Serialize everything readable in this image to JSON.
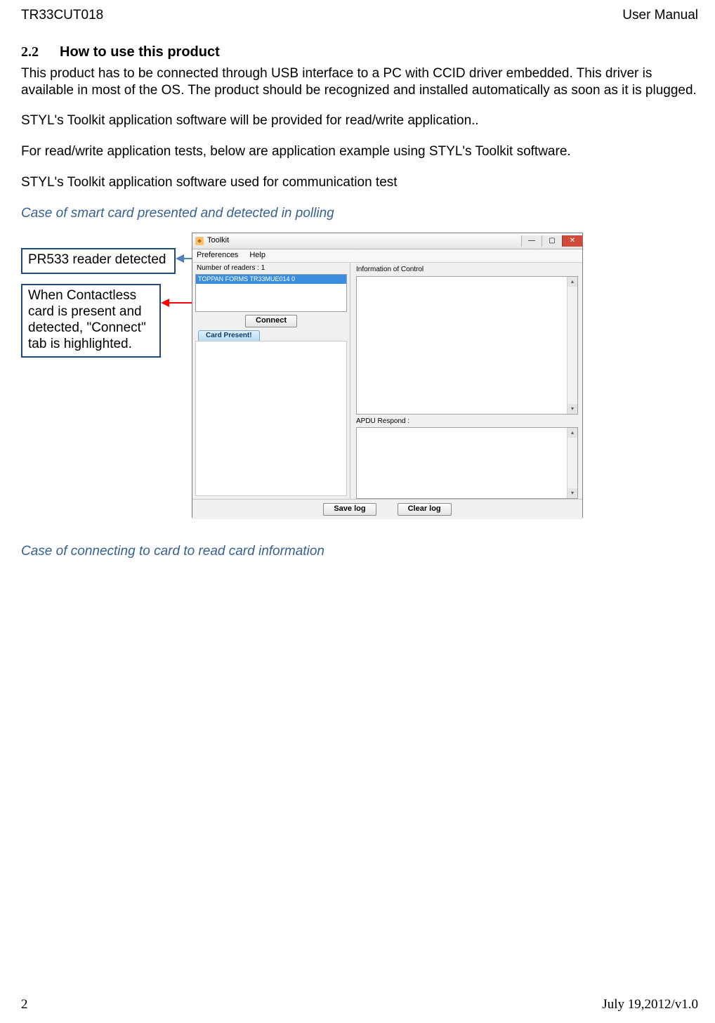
{
  "header": {
    "left": "TR33CUT018",
    "right": "User Manual"
  },
  "section": {
    "number": "2.2",
    "title": "How to use this product"
  },
  "paragraphs": {
    "p1": "This product has to be connected through USB interface to a PC with CCID driver embedded. This driver is available in most of the OS. The product should be recognized and installed automatically as soon as it is plugged.",
    "p2": "STYL's  Toolkit application software will be provided for read/write application..",
    "p3": "For read/write application tests, below are application example using STYL's  Toolkit software.",
    "p4": "STYL's Toolkit application software used for communication test",
    "case1": "Case of smart card presented and detected in polling",
    "case2": "Case of connecting to card to read card information"
  },
  "callouts": {
    "c1": "PR533 reader detected",
    "c2": "When Contactless card is present and detected, \"Connect\" tab is highlighted."
  },
  "shot": {
    "window_title": "Toolkit",
    "menus": {
      "preferences": "Preferences",
      "help": "Help"
    },
    "readers_label": "Number of readers : 1",
    "reader_item": "TOPPAN FORMS TR33MUE014 0",
    "connect_btn": "Connect",
    "tab_label": "Card Present!",
    "right_label_info": "Information of Control",
    "right_label_apdu": "APDU Respond :",
    "save_btn": "Save log",
    "clear_btn": "Clear log",
    "win_min": "—",
    "win_max": "▢",
    "win_close": "✕",
    "scroll_up": "▴",
    "scroll_down": "▾"
  },
  "footer": {
    "page": "2",
    "version": "July 19,2012/v1.0"
  }
}
